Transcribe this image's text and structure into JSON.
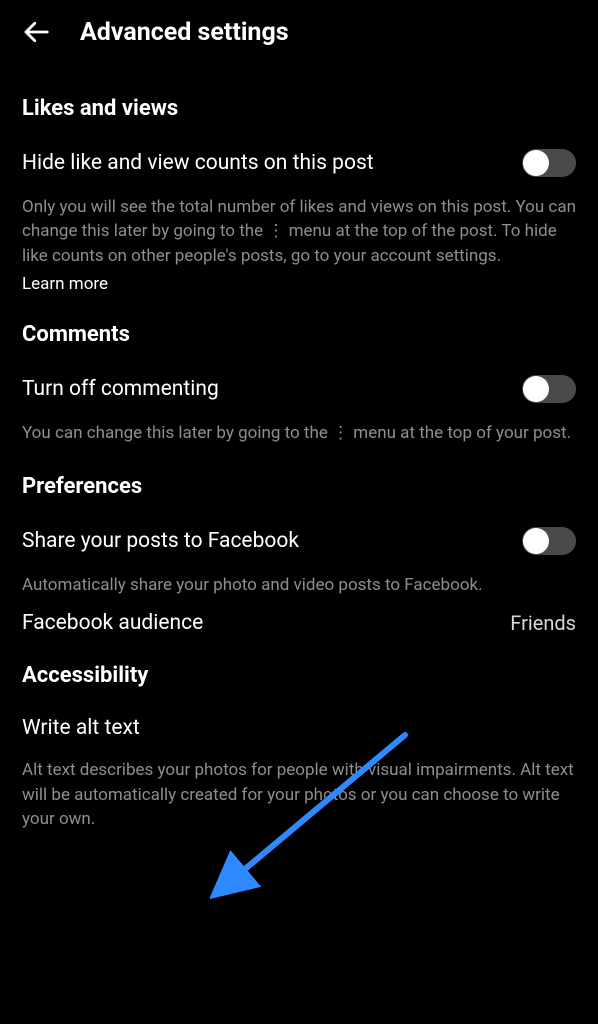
{
  "header": {
    "title": "Advanced settings"
  },
  "sections": {
    "likes": {
      "heading": "Likes and views",
      "hide_counts": {
        "label": "Hide like and view counts on this post",
        "description": "Only you will see the total number of likes and views on this post. You can change this later by going to the ⋮ menu at the top of the post. To hide like counts on other people's posts, go to your account settings.",
        "learn_more": "Learn more"
      }
    },
    "comments": {
      "heading": "Comments",
      "turn_off": {
        "label": "Turn off commenting",
        "description": "You can change this later by going to the ⋮ menu at the top of your post."
      }
    },
    "preferences": {
      "heading": "Preferences",
      "share_fb": {
        "label": "Share your posts to Facebook",
        "description": "Automatically share your photo and video posts to Facebook."
      },
      "fb_audience": {
        "label": "Facebook audience",
        "value": "Friends"
      }
    },
    "accessibility": {
      "heading": "Accessibility",
      "alt_text": {
        "label": "Write alt text",
        "description": "Alt text describes your photos for people with visual impairments. Alt text will be automatically created for your photos or you can choose to write your own."
      }
    }
  }
}
